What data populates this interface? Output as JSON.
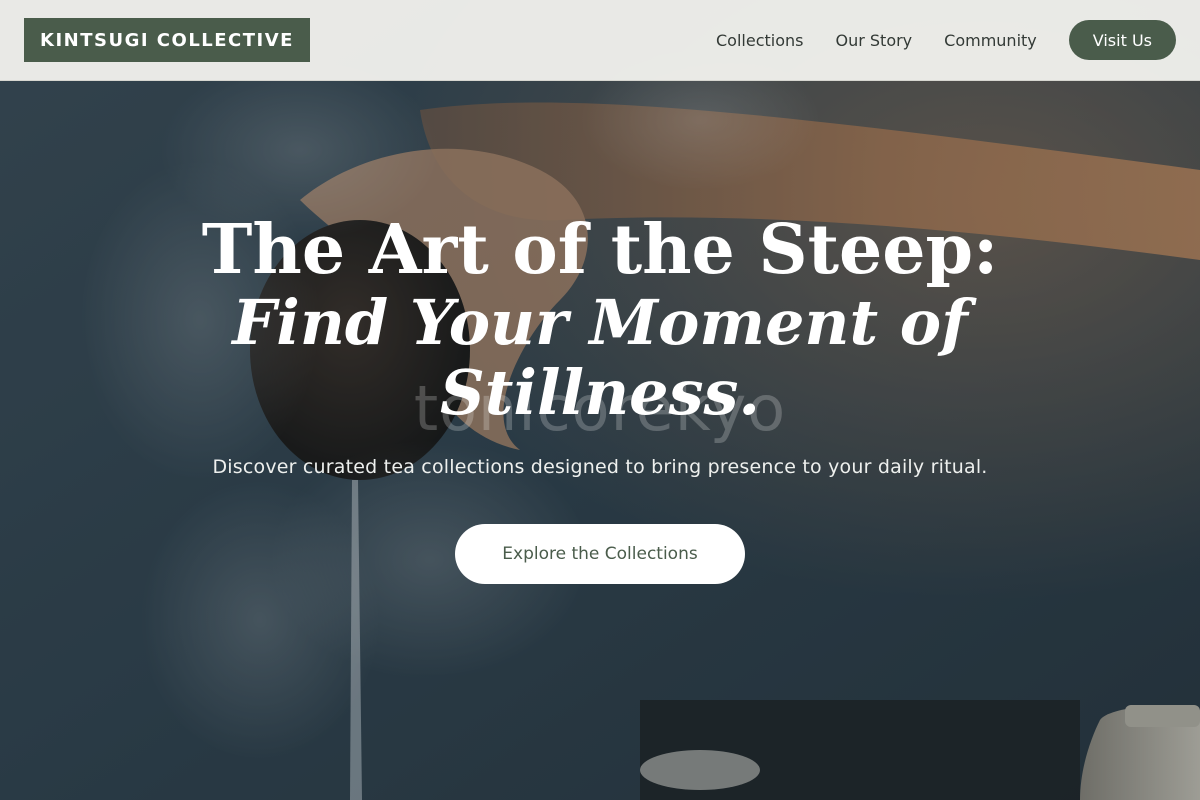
{
  "brand": {
    "logo_text": "KINTSUGI COLLECTIVE"
  },
  "nav": {
    "items": [
      {
        "label": "Collections"
      },
      {
        "label": "Our Story"
      },
      {
        "label": "Community"
      }
    ],
    "cta_label": "Visit Us"
  },
  "hero": {
    "title_line_1": "The Art of the Steep:",
    "title_line_2": "Find Your Moment of Stillness.",
    "subtitle": "Discover curated tea collections designed to bring presence to your daily ritual.",
    "cta_label": "Explore the Collections",
    "watermark_text": "tonicorekyo"
  },
  "colors": {
    "brand_green": "#4a5c4b",
    "header_bg": "#f0f0ec",
    "cta_bg": "#ffffff"
  }
}
